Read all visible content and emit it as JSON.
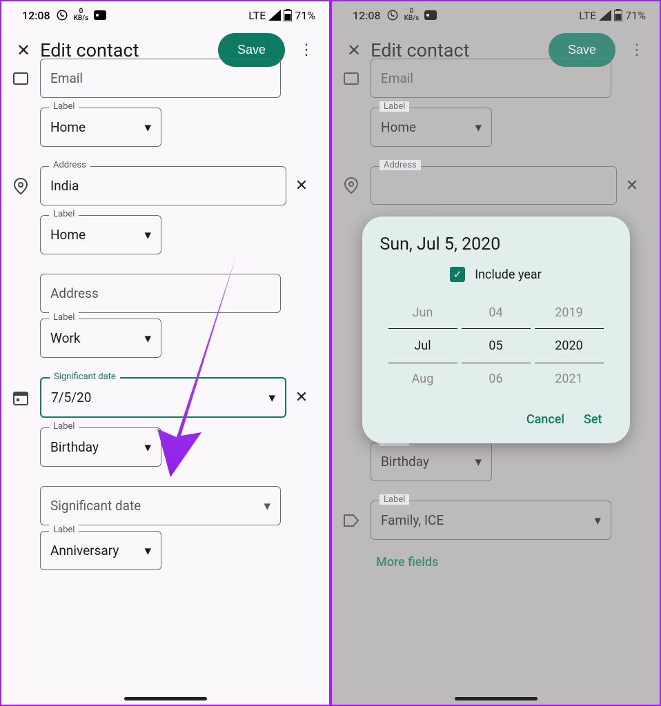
{
  "status": {
    "time": "12:08",
    "data_rate": "0",
    "data_unit": "KB/s",
    "network": "LTE",
    "battery": "71%"
  },
  "header": {
    "title": "Edit contact",
    "save_label": "Save"
  },
  "left": {
    "email_label": "Email",
    "email_type_label": "Label",
    "email_type_value": "Home",
    "address_label": "Address",
    "address_value": "India",
    "address_type_label": "Label",
    "address_type_value": "Home",
    "address2_placeholder": "Address",
    "address2_type_label": "Label",
    "address2_type_value": "Work",
    "sigdate_label": "Significant date",
    "sigdate_value": "7/5/20",
    "sigdate_type_label": "Label",
    "sigdate_type_value": "Birthday",
    "sigdate2_placeholder": "Significant date",
    "sigdate2_type_label": "Label",
    "sigdate2_type_value": "Anniversary"
  },
  "right": {
    "email_label": "Email",
    "email_type_label": "Label",
    "email_type_value": "Home",
    "address_label": "Address",
    "sigdate_type_label": "Label",
    "sigdate_type_value": "Birthday",
    "custom_label": "Label",
    "custom_value": "Family, ICE",
    "more_fields": "More fields"
  },
  "datepicker": {
    "title": "Sun, Jul 5, 2020",
    "include_year_label": "Include year",
    "month_prev": "Jun",
    "month_cur": "Jul",
    "month_next": "Aug",
    "day_prev": "04",
    "day_cur": "05",
    "day_next": "06",
    "year_prev": "2019",
    "year_cur": "2020",
    "year_next": "2021",
    "cancel": "Cancel",
    "set": "Set"
  }
}
